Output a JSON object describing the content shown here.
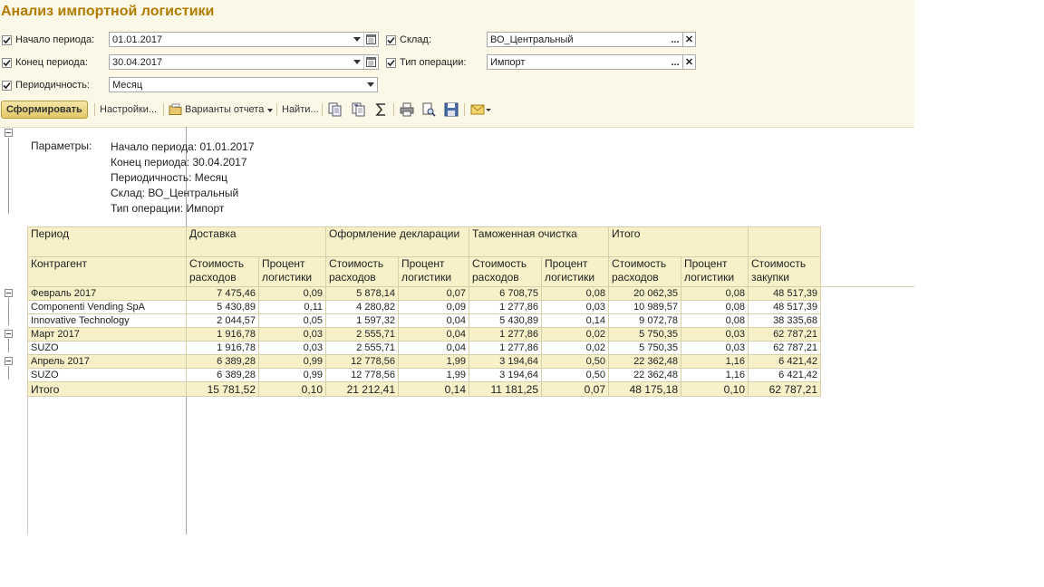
{
  "title": "Анализ импортной логистики",
  "filters": {
    "period_start": {
      "label": "Начало периода:",
      "value": "01.01.2017",
      "checked": true
    },
    "period_end": {
      "label": "Конец периода:",
      "value": "30.04.2017",
      "checked": true
    },
    "periodicity": {
      "label": "Периодичность:",
      "value": "Месяц",
      "checked": true
    },
    "warehouse": {
      "label": "Склад:",
      "value": "ВО_Центральный",
      "checked": true
    },
    "operation_type": {
      "label": "Тип операции:",
      "value": "Импорт",
      "checked": true
    }
  },
  "toolbar": {
    "generate": "Сформировать",
    "settings": "Настройки...",
    "variants": "Варианты отчета",
    "find": "Найти..."
  },
  "icons": [
    "copy-icon",
    "paste-icon",
    "sum-icon",
    "print-icon",
    "print-preview-icon",
    "save-icon",
    "email-icon"
  ],
  "report": {
    "params_label": "Параметры:",
    "params": [
      "Начало периода: 01.01.2017",
      "Конец периода: 30.04.2017",
      "Периодичность: Месяц",
      "Склад: ВО_Центральный",
      "Тип операции: Импорт"
    ],
    "header": {
      "period": "Период",
      "counterparty": "Контрагент",
      "delivery": "Доставка",
      "declarations": "Оформление декларации",
      "customs": "Таможенная очистка",
      "total": "Итого",
      "cost": "Стоимость расходов",
      "percent": "Процент логистики",
      "purchase": "Стоимость закупки"
    },
    "rows": [
      {
        "type": "group",
        "name": "Февраль 2017",
        "v": [
          "7 475,46",
          "0,09",
          "5 878,14",
          "0,07",
          "6 708,75",
          "0,08",
          "20 062,35",
          "0,08",
          "48 517,39"
        ]
      },
      {
        "type": "item",
        "name": "Componenti Vending SpA",
        "v": [
          "5 430,89",
          "0,11",
          "4 280,82",
          "0,09",
          "1 277,86",
          "0,03",
          "10 989,57",
          "0,08",
          "48 517,39"
        ]
      },
      {
        "type": "item",
        "name": "Innovative Technology",
        "v": [
          "2 044,57",
          "0,05",
          "1 597,32",
          "0,04",
          "5 430,89",
          "0,14",
          "9 072,78",
          "0,08",
          "38 335,68"
        ]
      },
      {
        "type": "group",
        "name": "Март 2017",
        "v": [
          "1 916,78",
          "0,03",
          "2 555,71",
          "0,04",
          "1 277,86",
          "0,02",
          "5 750,35",
          "0,03",
          "62 787,21"
        ]
      },
      {
        "type": "item",
        "name": "SUZO",
        "v": [
          "1 916,78",
          "0,03",
          "2 555,71",
          "0,04",
          "1 277,86",
          "0,02",
          "5 750,35",
          "0,03",
          "62 787,21"
        ]
      },
      {
        "type": "group",
        "name": "Апрель 2017",
        "v": [
          "6 389,28",
          "0,99",
          "12 778,56",
          "1,99",
          "3 194,64",
          "0,50",
          "22 362,48",
          "1,16",
          "6 421,42"
        ]
      },
      {
        "type": "item",
        "name": "SUZO",
        "v": [
          "6 389,28",
          "0,99",
          "12 778,56",
          "1,99",
          "3 194,64",
          "0,50",
          "22 362,48",
          "1,16",
          "6 421,42"
        ]
      }
    ],
    "total": {
      "name": "Итого",
      "v": [
        "15 781,52",
        "0,10",
        "21 212,41",
        "0,14",
        "11 181,25",
        "0,07",
        "48 175,18",
        "0,10",
        "62 787,21"
      ]
    }
  }
}
